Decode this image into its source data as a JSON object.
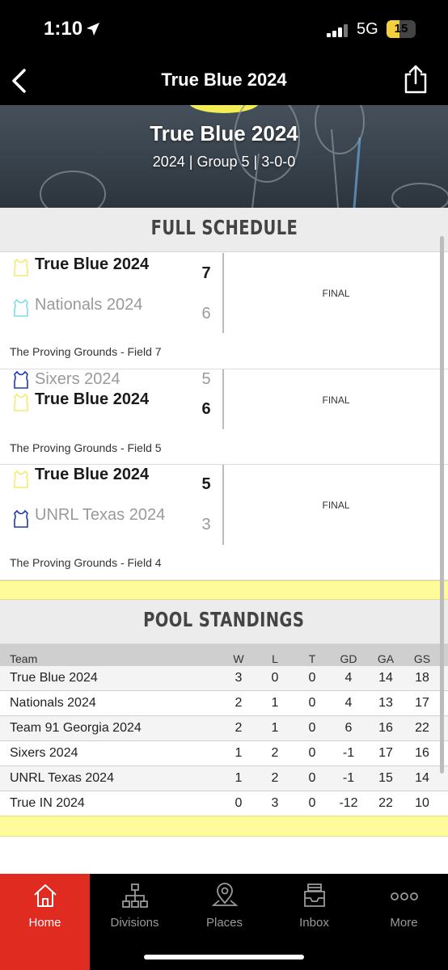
{
  "status_bar": {
    "time": "1:10",
    "network": "5G",
    "battery": "15"
  },
  "nav": {
    "title": "True Blue 2024"
  },
  "hero": {
    "title": "True Blue 2024",
    "subtitle": "2024 | Group 5 | 3-0-0"
  },
  "schedule": {
    "heading": "FULL SCHEDULE",
    "games": [
      {
        "team1": {
          "name": "True Blue 2024",
          "score": "7",
          "jersey_color": "#fffaa8",
          "result": "win"
        },
        "team2": {
          "name": "Nationals 2024",
          "score": "6",
          "jersey_color": "#8fe6f0",
          "result": "lose"
        },
        "status": "FINAL",
        "venue": "The Proving Grounds - Field 7"
      },
      {
        "team1": {
          "name": "Sixers 2024",
          "score": "5",
          "jersey_color": "#1f3ab0",
          "result": "lose"
        },
        "team2": {
          "name": "True Blue 2024",
          "score": "6",
          "jersey_color": "#fffaa8",
          "result": "win"
        },
        "status": "FINAL",
        "venue": "The Proving Grounds - Field 5"
      },
      {
        "team1": {
          "name": "True Blue 2024",
          "score": "5",
          "jersey_color": "#fffaa8",
          "result": "win"
        },
        "team2": {
          "name": "UNRL Texas 2024",
          "score": "3",
          "jersey_color": "#1f3ab0",
          "result": "lose"
        },
        "status": "FINAL",
        "venue": "The Proving Grounds - Field 4"
      }
    ]
  },
  "standings": {
    "heading": "POOL STANDINGS",
    "columns": [
      "Team",
      "W",
      "L",
      "T",
      "GD",
      "GA",
      "GS"
    ],
    "rows": [
      [
        "True Blue 2024",
        "3",
        "0",
        "0",
        "4",
        "14",
        "18"
      ],
      [
        "Nationals 2024",
        "2",
        "1",
        "0",
        "4",
        "13",
        "17"
      ],
      [
        "Team 91 Georgia 2024",
        "2",
        "1",
        "0",
        "6",
        "16",
        "22"
      ],
      [
        "Sixers 2024",
        "1",
        "2",
        "0",
        "-1",
        "17",
        "16"
      ],
      [
        "UNRL Texas 2024",
        "1",
        "2",
        "0",
        "-1",
        "15",
        "14"
      ],
      [
        "True IN 2024",
        "0",
        "3",
        "0",
        "-12",
        "22",
        "10"
      ]
    ]
  },
  "tab_bar": {
    "tabs": [
      {
        "label": "Home",
        "icon": "home-icon",
        "active": true
      },
      {
        "label": "Divisions",
        "icon": "divisions-icon",
        "active": false
      },
      {
        "label": "Places",
        "icon": "map-pin-icon",
        "active": false
      },
      {
        "label": "Inbox",
        "icon": "inbox-icon",
        "active": false
      },
      {
        "label": "More",
        "icon": "more-icon",
        "active": false
      }
    ]
  },
  "colors": {
    "accent": "#e02b20",
    "highlight_band": "#fefb9b",
    "nav_background": "#000000"
  }
}
